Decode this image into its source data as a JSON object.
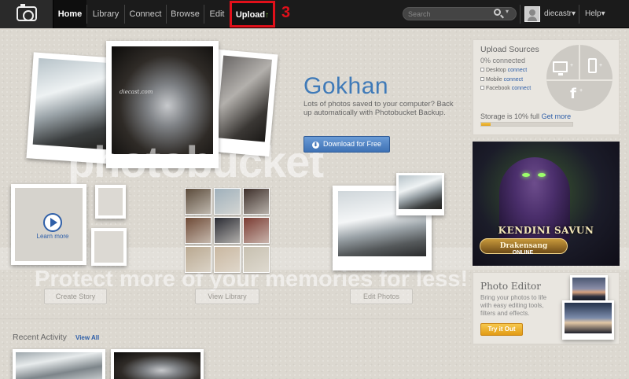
{
  "nav": {
    "items": [
      {
        "label": "Home",
        "active": true
      },
      {
        "label": "Library",
        "active": false
      },
      {
        "label": "Connect",
        "active": false
      },
      {
        "label": "Browse",
        "active": false
      },
      {
        "label": "Edit",
        "active": false
      }
    ],
    "upload_label": "Upload",
    "upload_arrow": "↑",
    "upload_step": "3",
    "search_placeholder": "Search",
    "search_chevron": "▾",
    "username": "diecastr▾",
    "help": "Help▾"
  },
  "watermark": {
    "brand": "photobucket",
    "tagline": "Protect more of your memories for less!"
  },
  "hero": {
    "name": "Gokhan",
    "description": "Lots of photos saved to your computer? Back up automatically with Photobucket Backup.",
    "download_icon": "⬇",
    "download_label": "Download for Free",
    "photo_caption": "diecast.com"
  },
  "tiles": {
    "learn_more": "Learn more"
  },
  "library_grid": [
    "#5a4a3a",
    "#9fb0bb",
    "#3d2f2a",
    "#6e4a36",
    "#2a2b33",
    "#7a3b32",
    "#b9a890",
    "#c9b7a0",
    "#c7c0b0"
  ],
  "actions": {
    "create_story": "Create Story",
    "view_library": "View Library",
    "edit_photos": "Edit Photos"
  },
  "recent": {
    "title": "Recent Activity",
    "view_all": "View All"
  },
  "upload_sources": {
    "title": "Upload Sources",
    "connected": "0% connected",
    "desktop_label": "Desktop",
    "mobile_label": "Mobile",
    "facebook_label": "Facebook",
    "connect_link": "connect",
    "plus": "+",
    "facebook_glyph": "f",
    "storage_text": "Storage is 10% full",
    "storage_link": "Get more",
    "storage_fraction": 0.1
  },
  "ad": {
    "title": "KENDINI SAVUN",
    "logo": "Drakensang",
    "logo_sub": "ONLINE"
  },
  "photo_editor": {
    "title": "Photo Editor",
    "description": "Bring your photos to life with easy editing tools, filters and effects.",
    "button": "Try it Out"
  },
  "colors": {
    "accent_blue": "#3f7ab8",
    "link_blue": "#2f5fa8",
    "highlight_red": "#e0101a",
    "button_orange": "#e29b15"
  }
}
